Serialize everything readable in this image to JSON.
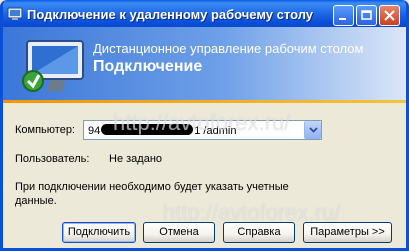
{
  "window": {
    "title": "Подключение к удаленному рабочему столу"
  },
  "banner": {
    "line1": "Дистанционное управление рабочим столом",
    "line2": "Подключение"
  },
  "form": {
    "computer_label": "Компьютер:",
    "computer_value_prefix": "94",
    "computer_value_suffix": "1 /admin",
    "user_label": "Пользователь:",
    "user_value": "Не задано",
    "info_line1": "При подключении необходимо будет указать учетные",
    "info_line2": "данные."
  },
  "buttons": {
    "connect": "Подключить",
    "cancel": "Отмена",
    "help": "Справка",
    "options": "Параметры >>"
  },
  "watermark": {
    "text": "http://avtoforex.ru/"
  },
  "colors": {
    "titlebar": "#0A4FD8",
    "banner_left": "#3B77D8",
    "stripe": "#F29600",
    "face": "#ECE9D8"
  }
}
